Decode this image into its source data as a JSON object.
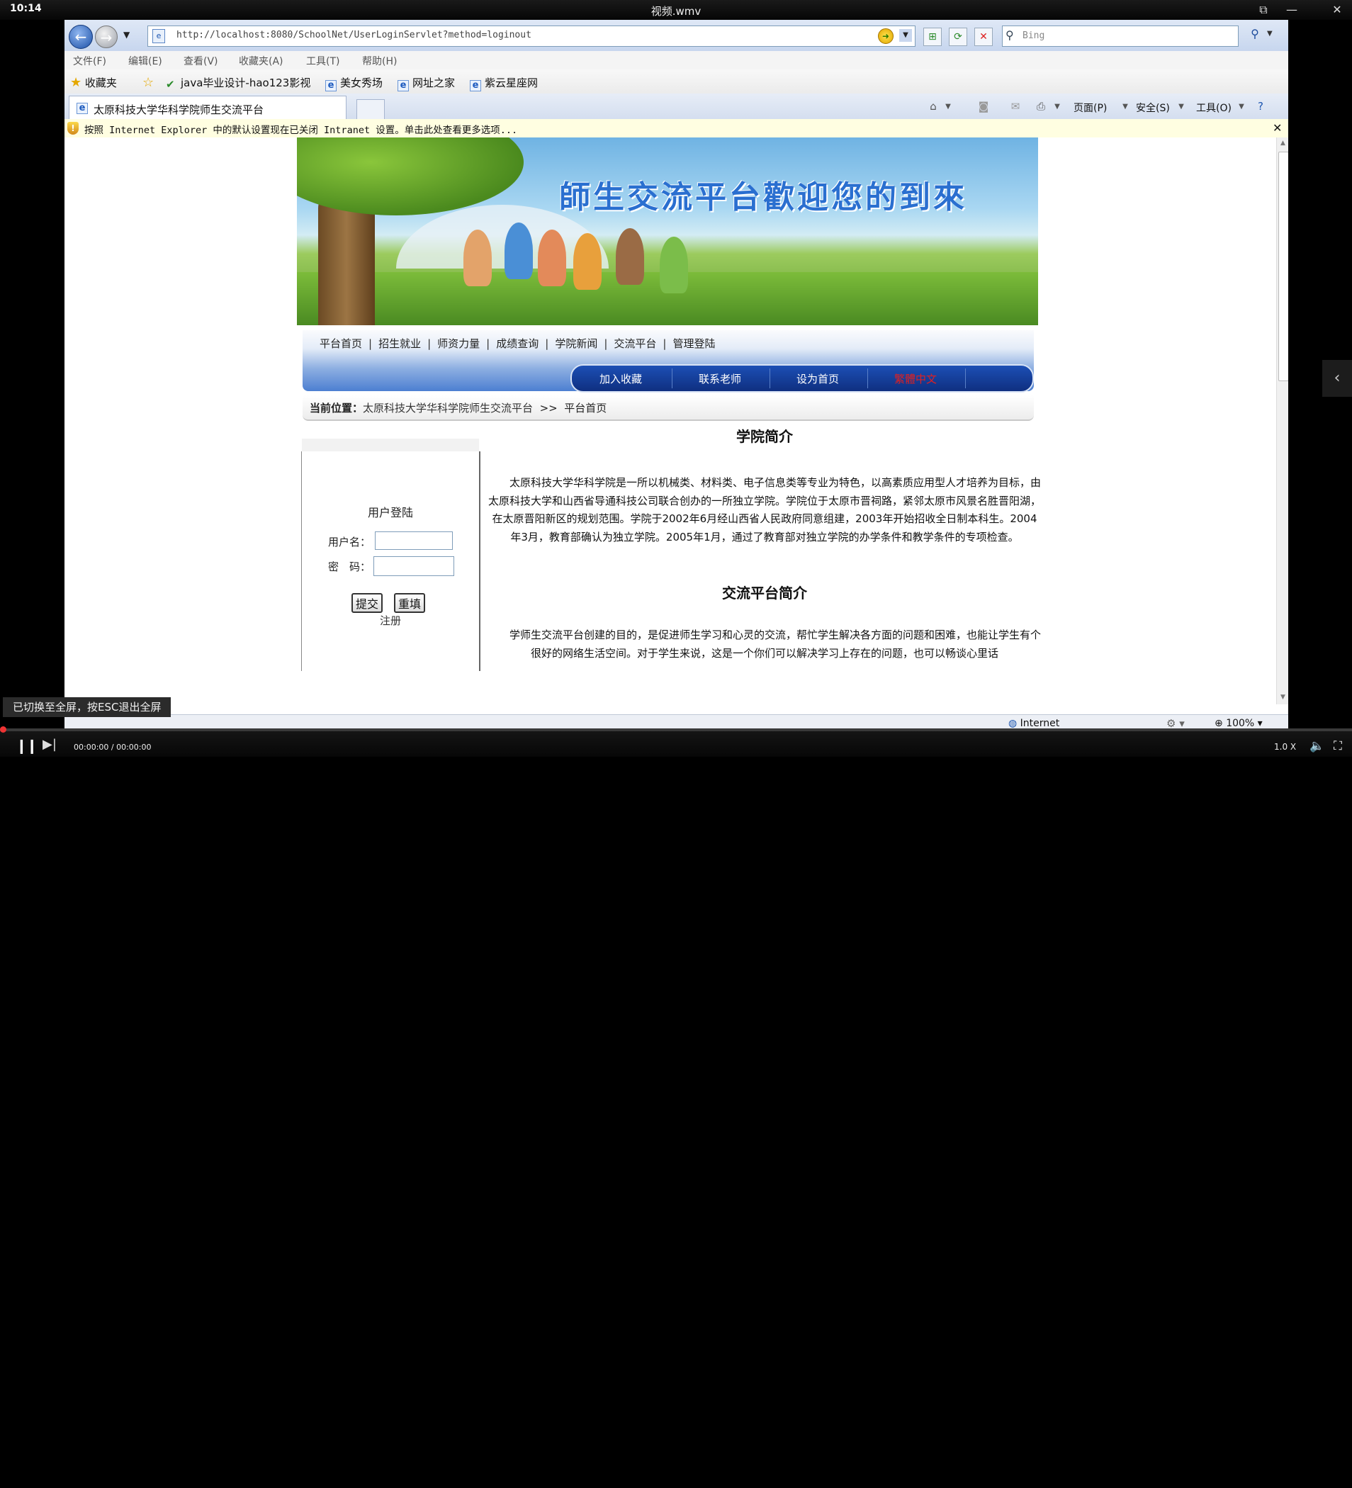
{
  "player": {
    "time": "10:14",
    "title": "视频.wmv",
    "clock": "00:00:00 / 00:00:00",
    "speed": "1.0 X",
    "toast": "已切换至全屏，按ESC退出全屏",
    "progress_fraction": 0.0
  },
  "ie": {
    "url": "http://localhost:8080/SchoolNet/UserLoginServlet?method=loginout",
    "search_placeholder": "Bing",
    "menu": [
      "文件(F)",
      "编辑(E)",
      "查看(V)",
      "收藏夹(A)",
      "工具(T)",
      "帮助(H)"
    ],
    "favorites": {
      "label": "收藏夹",
      "items": [
        "java毕业设计-hao123影视",
        "美女秀场",
        "网址之家",
        "紫云星座网"
      ]
    },
    "tab_title": "太原科技大学华科学院师生交流平台",
    "commands": {
      "page": "页面(P)",
      "safety": "安全(S)",
      "tools": "工具(O)"
    },
    "info_bar": "按照 Internet Explorer 中的默认设置现在已关闭 Intranet 设置。单击此处查看更多选项...",
    "status": {
      "zone": "Internet",
      "zoom": "100%"
    }
  },
  "site": {
    "banner_title": "師生交流平台歡迎您的到來",
    "main_nav": [
      "平台首页",
      "招生就业",
      "师资力量",
      "成绩查询",
      "学院新闻",
      "交流平台",
      "管理登陆"
    ],
    "sub_nav": [
      "加入收藏",
      "联系老师",
      "设为首页",
      "繁體中文"
    ],
    "breadcrumb": {
      "label": "当前位置：",
      "site": "太原科技大学华科学院师生交流平台",
      "separator": ">>",
      "current": "平台首页"
    },
    "login": {
      "title": "用户登陆",
      "username_label": "用户名：",
      "password_label": "密　码：",
      "submit": "提交",
      "reset": "重填",
      "register": "注册"
    },
    "article": {
      "title1": "学院简介",
      "para1": "太原科技大学华科学院是一所以机械类、材料类、电子信息类等专业为特色，以高素质应用型人才培养为目标，由太原科技大学和山西省导通科技公司联合创办的一所独立学院。学院位于太原市晋祠路，紧邻太原市风景名胜晋阳湖，在太原晋阳新区的规划范围。学院于2002年6月经山西省人民政府同意组建，2003年开始招收全日制本科生。2004年3月，教育部确认为独立学院。2005年1月，通过了教育部对独立学院的办学条件和教学条件的专项检查。",
      "title2": "交流平台简介",
      "para2": "学师生交流平台创建的目的，是促进师生学习和心灵的交流，帮忙学生解决各方面的问题和困难，也能让学生有个很好的网络生活空间。对于学生来说，这是一个你们可以解决学习上存在的问题，也可以畅谈心里话"
    }
  },
  "colors": {
    "ie_chrome": "#dfe8f6",
    "sub_nav_bg": "#1c4fb5",
    "sub_nav_highlight": "#e02020",
    "info_bar": "#fffee1"
  }
}
